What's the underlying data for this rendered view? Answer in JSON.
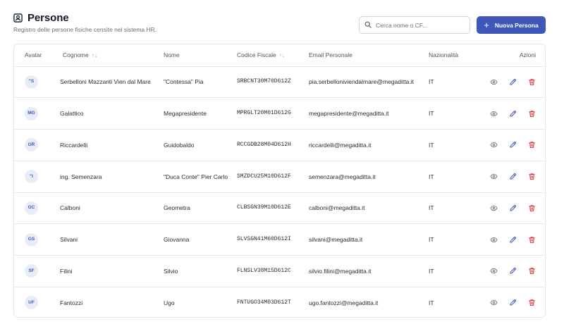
{
  "header": {
    "title": "Persone",
    "subtitle": "Registro delle persone fisiche censite nel sistema HR."
  },
  "search": {
    "placeholder": "Cerca nome o CF...",
    "value": ""
  },
  "new_button": {
    "plus": "+",
    "label": "Nuova Persona"
  },
  "columns": {
    "avatar": "Avatar",
    "cognome": "Cognome",
    "nome": "Nome",
    "codice_fiscale": "Codice Fiscale",
    "email": "Email Personale",
    "nazionalita": "Nazionalità",
    "azioni": "Azioni",
    "sort_indicator": "↑↓"
  },
  "rows": [
    {
      "initials": "\"S",
      "cognome": "Serbelloni Mazzanti Vien dal Mare",
      "nome": "\"Contessa\" Pia",
      "cf": "SRBCNT30M70D612Z",
      "email": "pia.serbelloniviendalmare@megaditta.it",
      "naz": "IT"
    },
    {
      "initials": "MG",
      "cognome": "Galattico",
      "nome": "Megapresidente",
      "cf": "MPRGLT20M01D612G",
      "email": "megapresidente@megaditta.it",
      "naz": "IT"
    },
    {
      "initials": "GR",
      "cognome": "Riccardelli",
      "nome": "Guidobaldo",
      "cf": "RCCGDB28M04D612H",
      "email": "riccardelli@megaditta.it",
      "naz": "IT"
    },
    {
      "initials": "\"I",
      "cognome": "ing. Semenzara",
      "nome": "\"Duca Conte\" Pier Carlo",
      "cf": "SMZDCU25M10D612F",
      "email": "semenzara@megaditta.it",
      "naz": "IT"
    },
    {
      "initials": "GC",
      "cognome": "Calboni",
      "nome": "Geometra",
      "cf": "CLBSGN39M10D612E",
      "email": "calboni@megaditta.it",
      "naz": "IT"
    },
    {
      "initials": "GS",
      "cognome": "Silvani",
      "nome": "Giovanna",
      "cf": "SLVSGN41M60D612I",
      "email": "silvani@megaditta.it",
      "naz": "IT"
    },
    {
      "initials": "SF",
      "cognome": "Filini",
      "nome": "Silvio",
      "cf": "FLNSLV38M15D612C",
      "email": "silvio.filini@megaditta.it",
      "naz": "IT"
    },
    {
      "initials": "UF",
      "cognome": "Fantozzi",
      "nome": "Ugo",
      "cf": "FNTUGO34M03D612T",
      "email": "ugo.fantozzi@megaditta.it",
      "naz": "IT"
    }
  ],
  "icons": {
    "title": "contact-card-icon",
    "search": "search-icon",
    "view": "eye-icon",
    "edit": "pencil-icon",
    "delete": "trash-icon"
  },
  "colors": {
    "primary": "#3f57b8",
    "avatar_bg": "#e8ecf7",
    "delete": "#dc2626",
    "edit": "#3f57b8",
    "view": "#6b7280"
  }
}
